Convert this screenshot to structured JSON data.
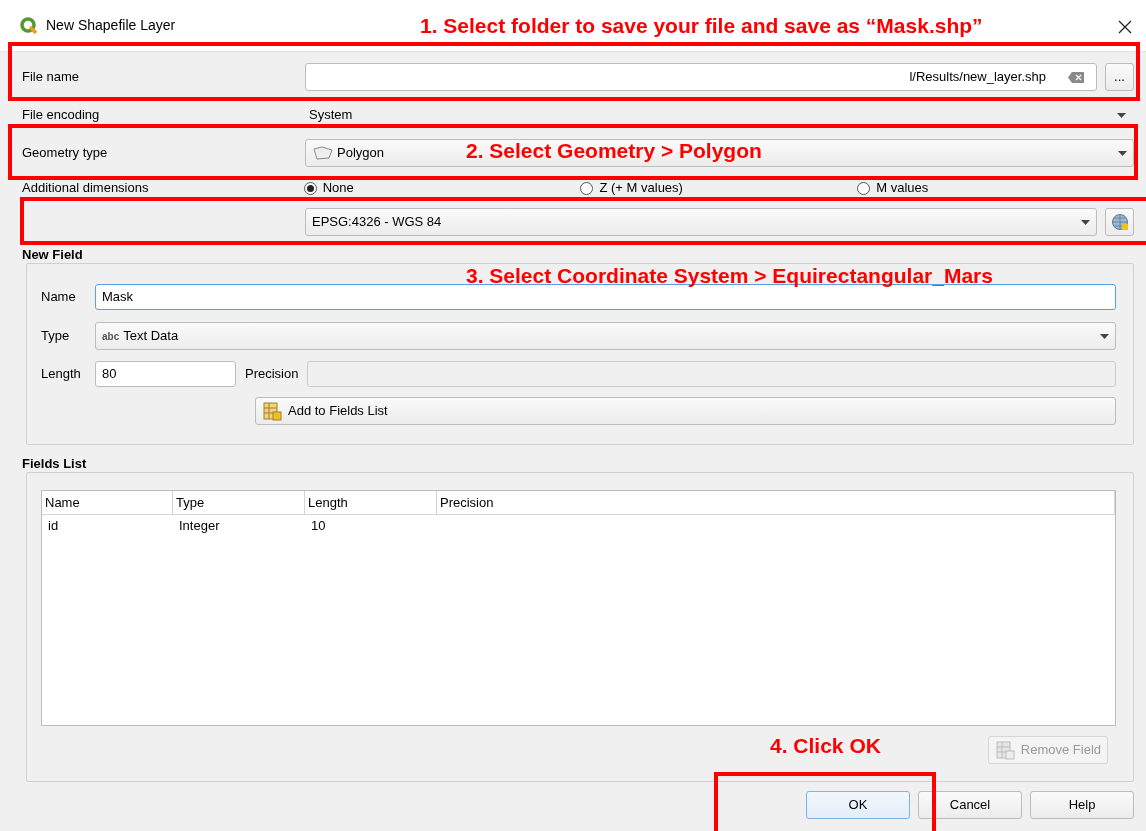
{
  "window": {
    "title": "New Shapefile Layer"
  },
  "annotations": [
    {
      "text": "1. Select folder to save your file and save as “Mask.shp”"
    },
    {
      "text": "2. Select Geometry > Polygon"
    },
    {
      "text": "3. Select Coordinate System > Equirectangular_Mars"
    },
    {
      "text": "4. Click OK"
    }
  ],
  "file_name": {
    "label": "File name",
    "value": "l/Results/new_layer.shp",
    "browse": "..."
  },
  "file_encoding": {
    "label": "File encoding",
    "value": "System"
  },
  "geometry_type": {
    "label": "Geometry type",
    "value": "Polygon"
  },
  "additional_dimensions": {
    "label": "Additional dimensions",
    "options": [
      {
        "label": "None",
        "selected": true
      },
      {
        "label": "Z (+ M values)",
        "selected": false
      },
      {
        "label": "M values",
        "selected": false
      }
    ]
  },
  "crs": {
    "value": "EPSG:4326 - WGS 84"
  },
  "new_field": {
    "title": "New Field",
    "name_label": "Name",
    "name_value": "Mask",
    "type_label": "Type",
    "type_prefix": "abc",
    "type_value": "Text Data",
    "length_label": "Length",
    "length_value": "80",
    "precision_label": "Precision",
    "precision_disabled": true,
    "add_button": "Add to Fields List"
  },
  "fields_list": {
    "title": "Fields List",
    "columns": [
      "Name",
      "Type",
      "Length",
      "Precision"
    ],
    "rows": [
      [
        "id",
        "Integer",
        "10",
        ""
      ]
    ],
    "remove_button": {
      "label": "Remove Field",
      "disabled": true
    }
  },
  "buttons": [
    {
      "label": "OK",
      "default": true
    },
    {
      "label": "Cancel",
      "default": false
    },
    {
      "label": "Help",
      "default": false
    }
  ]
}
